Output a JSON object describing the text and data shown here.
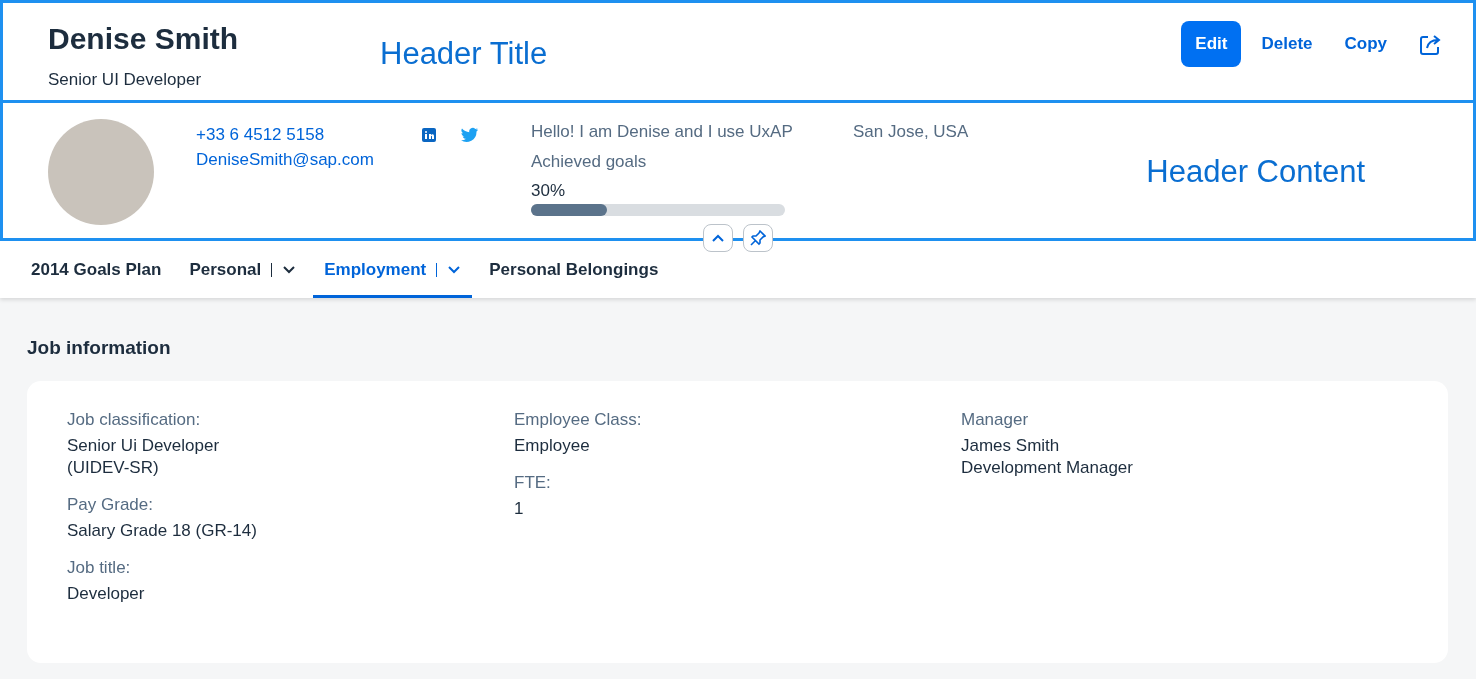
{
  "header_title": {
    "name": "Denise Smith",
    "subtitle": "Senior UI Developer",
    "annotation": "Header Title",
    "actions": [
      {
        "label": "Edit",
        "kind": "emphasized"
      },
      {
        "label": "Delete",
        "kind": "transparent"
      },
      {
        "label": "Copy",
        "kind": "transparent"
      },
      {
        "kind": "share-icon"
      }
    ]
  },
  "header_content": {
    "annotation": "Header Content",
    "phone": "+33 6 4512 5158",
    "email": "DeniseSmith@sap.com",
    "intro": "Hello! I am Denise and I use UxAP",
    "location": "San Jose, USA",
    "progress": {
      "label": "Achieved goals",
      "reading": "30%",
      "level": 0.3
    }
  },
  "tabs": [
    {
      "label": "2014 Goals Plan",
      "selected": false,
      "has_menu": false
    },
    {
      "label": "Personal",
      "selected": false,
      "has_menu": true
    },
    {
      "label": "Employment",
      "selected": true,
      "has_menu": true
    },
    {
      "label": "Personal Belongings",
      "selected": false,
      "has_menu": false
    }
  ],
  "section": {
    "title": "Job information",
    "columns": [
      [
        {
          "label": "Job classification:",
          "lines": [
            "Senior Ui Developer",
            "(UIDEV-SR)"
          ]
        },
        {
          "label": "Pay Grade:",
          "lines": [
            "Salary Grade 18 (GR-14)"
          ]
        },
        {
          "label": "Job title:",
          "lines": [
            "Developer"
          ]
        }
      ],
      [
        {
          "label": "Employee Class:",
          "lines": [
            "Employee"
          ]
        },
        {
          "label": "FTE:",
          "lines": [
            "1"
          ]
        }
      ],
      [
        {
          "label": "Manager",
          "lines": [
            "James Smith",
            "Development Manager"
          ]
        }
      ]
    ]
  }
}
